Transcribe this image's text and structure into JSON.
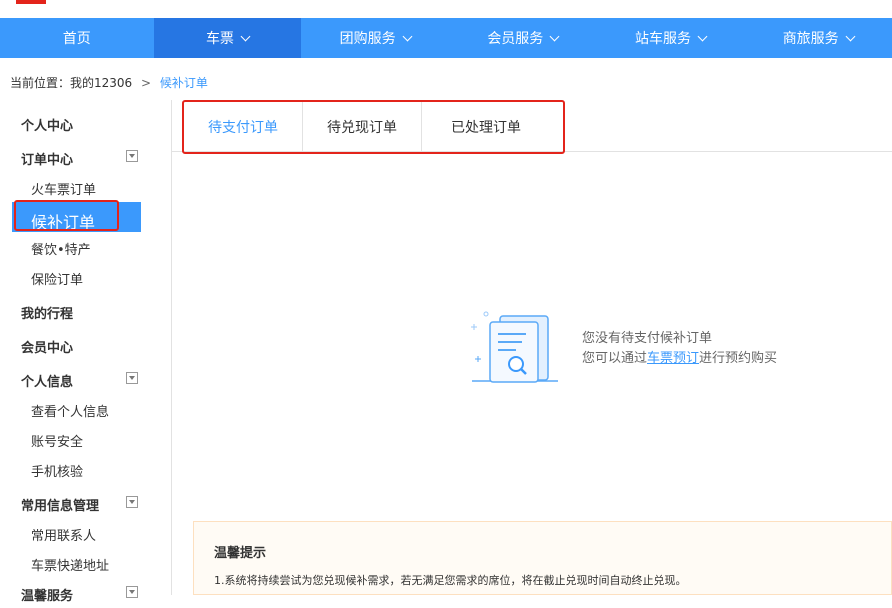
{
  "nav": {
    "items": [
      {
        "label": "首页",
        "dropdown": false,
        "active": false
      },
      {
        "label": "车票",
        "dropdown": true,
        "active": true
      },
      {
        "label": "团购服务",
        "dropdown": true,
        "active": false
      },
      {
        "label": "会员服务",
        "dropdown": true,
        "active": false
      },
      {
        "label": "站车服务",
        "dropdown": true,
        "active": false
      },
      {
        "label": "商旅服务",
        "dropdown": true,
        "active": false
      }
    ]
  },
  "breadcrumb": {
    "prefix": "当前位置：我的12306",
    "separator": ">",
    "current": "候补订单"
  },
  "sidebar": {
    "groups": [
      {
        "label": "个人中心"
      },
      {
        "label": "订单中心",
        "collapsible": true
      },
      {
        "label": "火车票订单",
        "sub": true
      },
      {
        "label": "候补订单",
        "sub": true,
        "selected": true
      },
      {
        "label": "餐饮•特产",
        "sub": true
      },
      {
        "label": "保险订单",
        "sub": true
      },
      {
        "label": "我的行程"
      },
      {
        "label": "会员中心"
      },
      {
        "label": "个人信息",
        "collapsible": true
      },
      {
        "label": "查看个人信息",
        "sub": true
      },
      {
        "label": "账号安全",
        "sub": true
      },
      {
        "label": "手机核验",
        "sub": true
      },
      {
        "label": "常用信息管理",
        "collapsible": true
      },
      {
        "label": "常用联系人",
        "sub": true
      },
      {
        "label": "车票快递地址",
        "sub": true
      },
      {
        "label": "温馨服务",
        "collapsible": true
      }
    ]
  },
  "tabs": [
    {
      "label": "待支付订单",
      "active": true
    },
    {
      "label": "待兑现订单",
      "active": false
    },
    {
      "label": "已处理订单",
      "active": false
    }
  ],
  "empty": {
    "line1": "您没有待支付候补订单",
    "line2_prefix": "您可以通过",
    "line2_link": "车票预订",
    "line2_suffix": "进行预约购买"
  },
  "tips": {
    "title": "温馨提示",
    "line1": "1.系统将持续尝试为您兑现候补需求，若无满足您需求的席位，将在截止兑现时间自动终止兑现。"
  },
  "colors": {
    "accent": "#3b99fc",
    "nav_active": "#2676e3",
    "highlight_red": "#e3241b"
  }
}
